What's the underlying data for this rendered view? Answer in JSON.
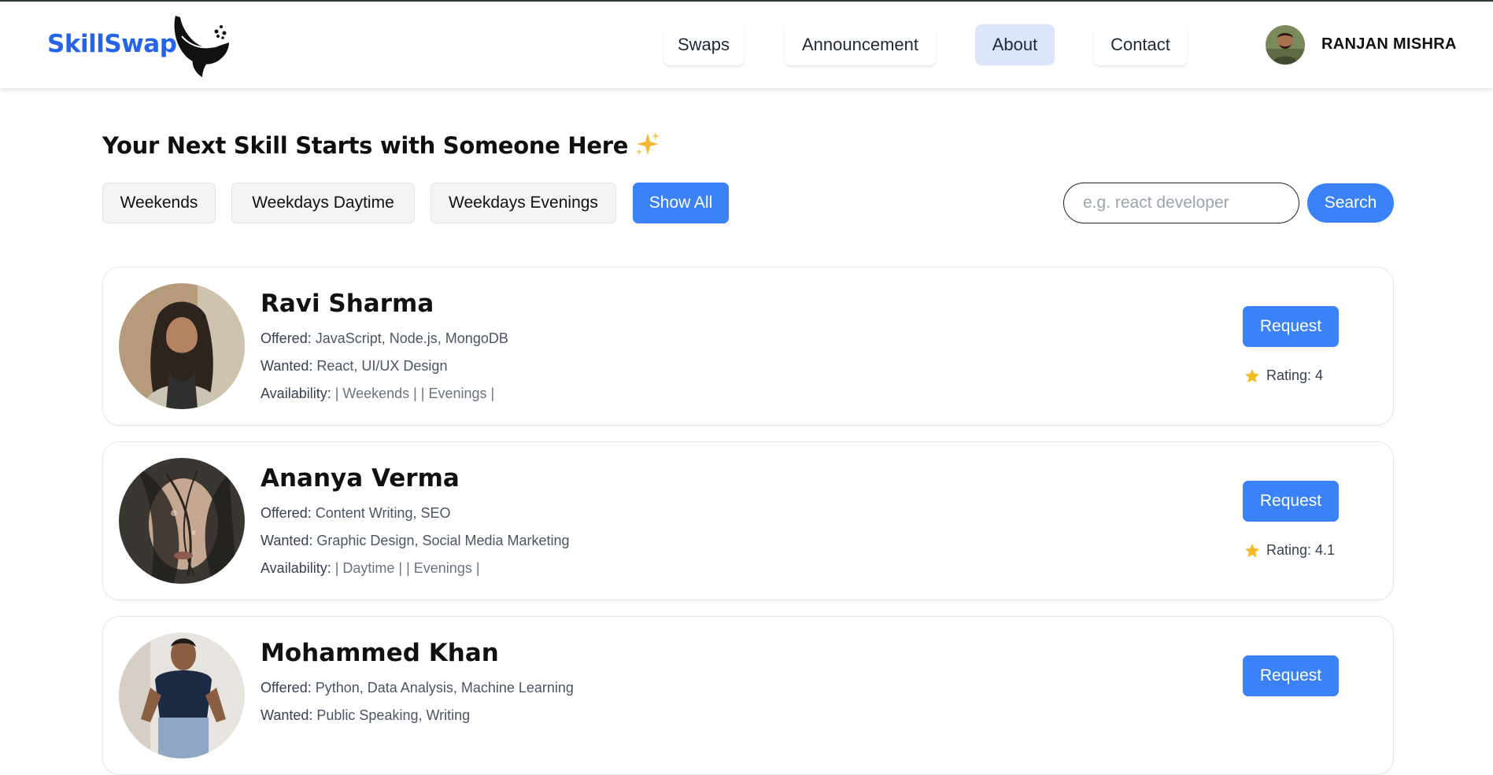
{
  "app": {
    "logo_text": "SkillSwap",
    "brand_color": "#2563eb",
    "accent_color": "#3b82f6"
  },
  "nav": {
    "items": [
      {
        "label": "Swaps",
        "active": false
      },
      {
        "label": "Announcement",
        "active": false
      },
      {
        "label": "About",
        "active": true
      },
      {
        "label": "Contact",
        "active": false
      }
    ]
  },
  "user": {
    "name": "RANJAN MISHRA"
  },
  "main": {
    "title": "Your Next Skill Starts with Someone Here",
    "filters": [
      {
        "label": "Weekends"
      },
      {
        "label": "Weekdays Daytime"
      },
      {
        "label": "Weekdays Evenings"
      },
      {
        "label": "Show All",
        "selected": true
      }
    ],
    "search": {
      "placeholder": "e.g. react developer",
      "value": "",
      "button_label": "Search"
    }
  },
  "profiles": [
    {
      "name": "Ravi Sharma",
      "offered_label": "Offered:",
      "offered": "JavaScript, Node.js, MongoDB",
      "wanted_label": "Wanted:",
      "wanted": "React, UI/UX Design",
      "availability_label": "Availability:",
      "availability": "| Weekends | | Evenings |",
      "request_label": "Request",
      "rating_text": "Rating: 4"
    },
    {
      "name": "Ananya Verma",
      "offered_label": "Offered:",
      "offered": "Content Writing, SEO",
      "wanted_label": "Wanted:",
      "wanted": "Graphic Design, Social Media Marketing",
      "availability_label": "Availability:",
      "availability": "| Daytime | | Evenings |",
      "request_label": "Request",
      "rating_text": "Rating: 4.1"
    },
    {
      "name": "Mohammed Khan",
      "offered_label": "Offered:",
      "offered": "Python, Data Analysis, Machine Learning",
      "wanted_label": "Wanted:",
      "wanted": "Public Speaking, Writing",
      "request_label": "Request"
    }
  ]
}
